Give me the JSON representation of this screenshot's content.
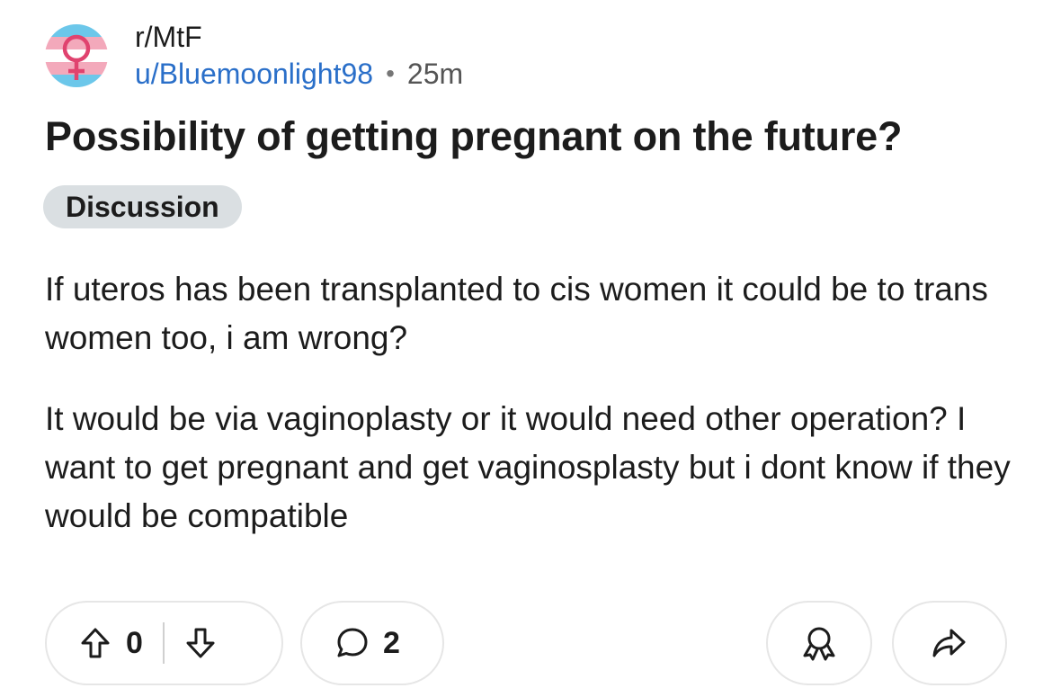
{
  "post": {
    "subreddit": "r/MtF",
    "username": "u/Bluemoonlight98",
    "separator": "•",
    "age": "25m",
    "title": "Possibility of getting pregnant on the future?",
    "flair": "Discussion",
    "body": [
      "If uteros has been transplanted to cis women it could be to trans women too, i am wrong?",
      "It would be via vaginoplasty or it would need other operation? I want to get pregnant and get vaginosplasty but i dont know if they would be compatible"
    ]
  },
  "actions": {
    "upvote_count": "0",
    "comment_count": "2"
  },
  "icons": {
    "avatar": "transgender-flag-female-symbol-icon",
    "upvote": "arrow-up-icon",
    "downvote": "arrow-down-icon",
    "comment": "speech-bubble-icon",
    "award": "award-ribbon-icon",
    "share": "share-arrow-icon"
  },
  "colors": {
    "flag_blue": "#6cc7ea",
    "flag_pink": "#f3a9bb",
    "flag_white": "#ffffff",
    "venus_symbol": "#e0436f",
    "username": "#2a6fc9",
    "flair_background": "#dadfe2",
    "text": "#1c1c1c"
  }
}
